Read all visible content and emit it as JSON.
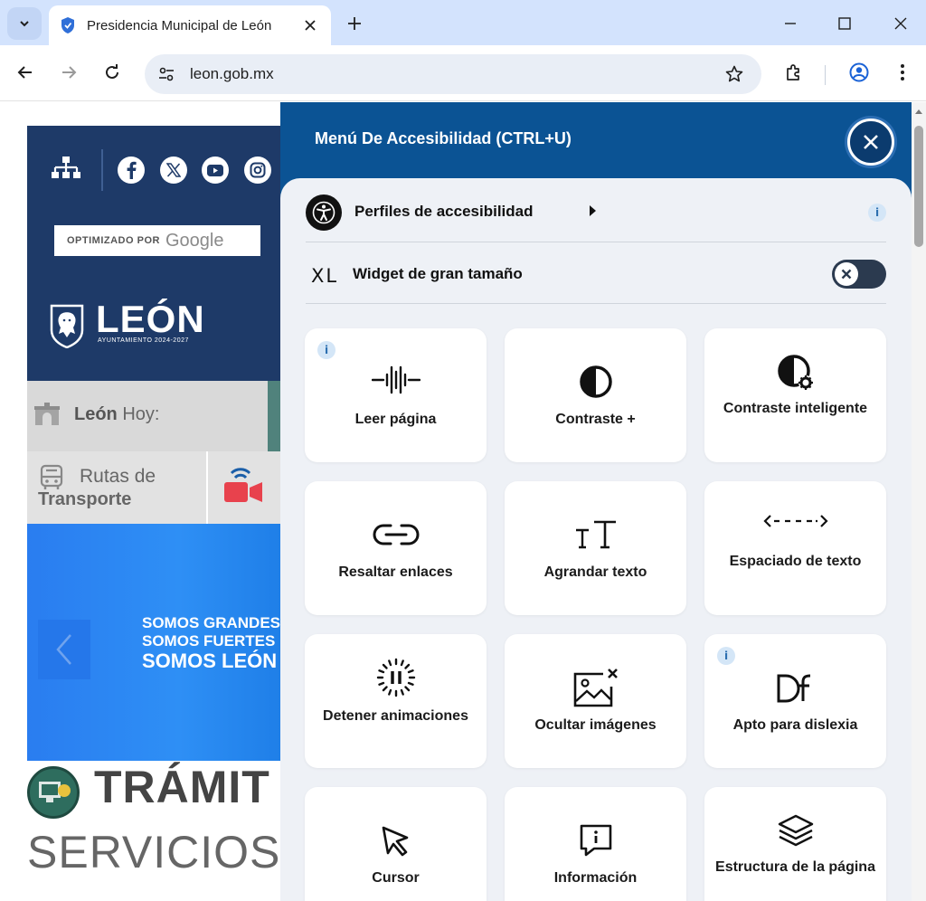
{
  "browser": {
    "tab_title": "Presidencia Municipal de León",
    "url": "leon.gob.mx"
  },
  "site": {
    "google_prefix": "OPTIMIZADO POR",
    "google_word": "Google",
    "logo_word": "LEÓN",
    "logo_sub": "AYUNTAMIENTO 2024-2027",
    "hoy_bold": "León",
    "hoy_rest": " Hoy:",
    "rutas_l1": "Rutas de",
    "rutas_l2": "Transporte",
    "banner": [
      "SOMOS GRANDES",
      "SOMOS FUERTES",
      "SOMOS LEÓN"
    ],
    "tramites": "TRÁMIT",
    "servicios": "SERVICIOS"
  },
  "accessibility": {
    "title": "Menú De Accesibilidad (CTRL+U)",
    "profiles_label": "Perfiles de accesibilidad",
    "info_glyph": "i",
    "xl_tag": "XL",
    "xl_label": "Widget de gran tamaño",
    "toggle_on": false,
    "tiles": [
      {
        "label": "Leer página",
        "icon": "read-page-icon",
        "info": true
      },
      {
        "label": "Contraste +",
        "icon": "contrast-icon",
        "info": false
      },
      {
        "label": "Contraste inteligente",
        "icon": "smart-contrast-icon",
        "info": false
      },
      {
        "label": "Resaltar enlaces",
        "icon": "link-icon",
        "info": false
      },
      {
        "label": "Agrandar texto",
        "icon": "text-size-icon",
        "info": false
      },
      {
        "label": "Espaciado de texto",
        "icon": "text-spacing-icon",
        "info": false
      },
      {
        "label": "Detener animaciones",
        "icon": "pause-icon",
        "info": false
      },
      {
        "label": "Ocultar imágenes",
        "icon": "hide-images-icon",
        "info": false
      },
      {
        "label": "Apto para dislexia",
        "icon": "dyslexia-icon",
        "info": true
      },
      {
        "label": "Cursor",
        "icon": "cursor-icon",
        "info": false
      },
      {
        "label": "Información",
        "icon": "info-bubble-icon",
        "info": false
      },
      {
        "label": "Estructura de la página",
        "icon": "layers-icon",
        "info": false
      }
    ]
  },
  "colors": {
    "panel_blue": "#0b5394",
    "header_navy": "#1e3a68",
    "banner_blue": "#2e8ff5",
    "chrome_blue": "#d3e3fd"
  }
}
